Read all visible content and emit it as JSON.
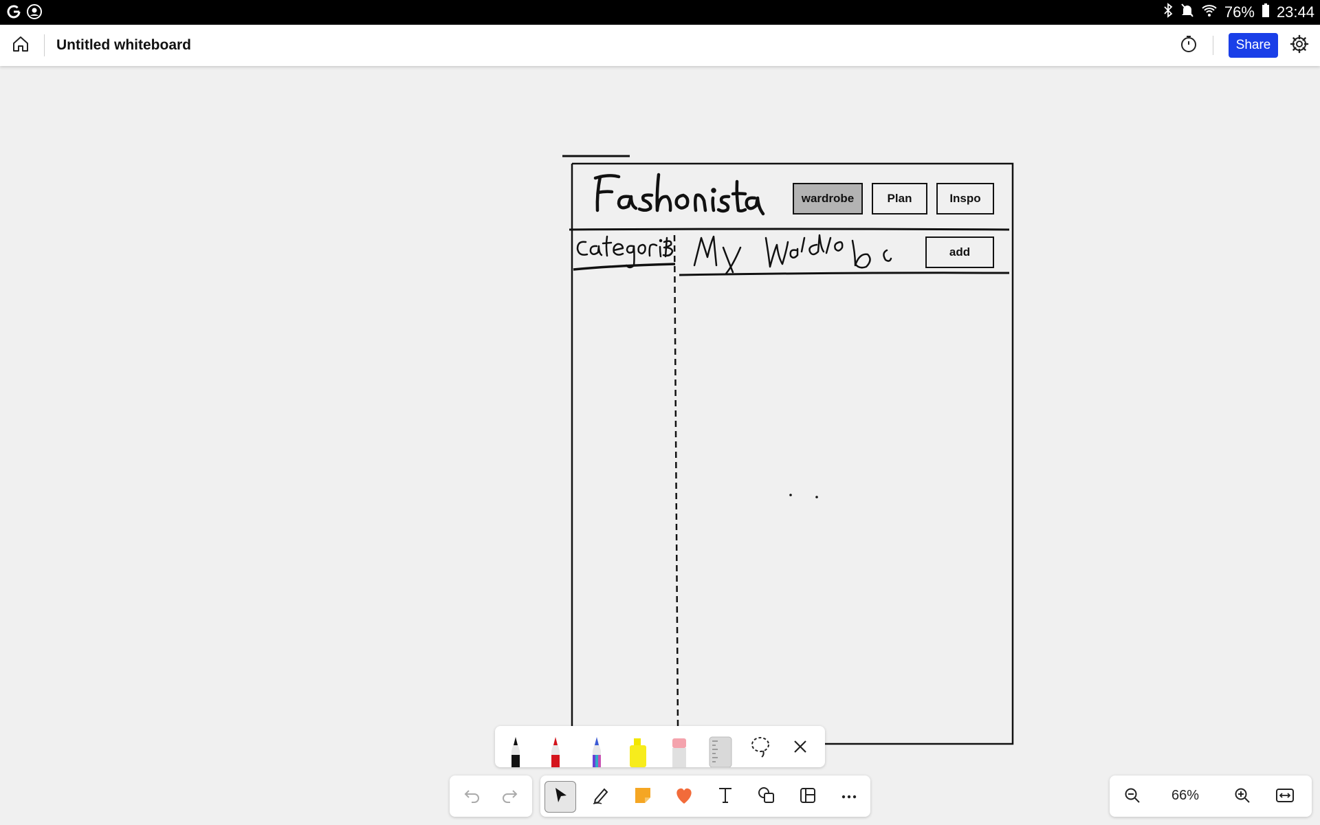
{
  "status_bar": {
    "left_icons": [
      "google-icon",
      "account-icon"
    ],
    "right_icons": [
      "bluetooth-icon",
      "mute-icon",
      "wifi-icon",
      "battery-icon"
    ],
    "battery": "76%",
    "time": "23:44"
  },
  "app_bar": {
    "title": "Untitled whiteboard",
    "share_label": "Share",
    "icons": [
      "home-icon",
      "timer-icon",
      "settings-icon"
    ]
  },
  "whiteboard": {
    "wireframe": {
      "handwritten": {
        "logo": "Fashonista",
        "sidebar_heading": "Categories",
        "main_heading": "My Wardrobe"
      },
      "nav_buttons": [
        {
          "label": "wardrobe",
          "active": true
        },
        {
          "label": "Plan",
          "active": false
        },
        {
          "label": "Inspo",
          "active": false
        }
      ],
      "add_button": "add"
    }
  },
  "pen_tray": {
    "tools": [
      "black-pen",
      "red-pen",
      "galaxy-pen",
      "yellow-highlighter",
      "pink-eraser",
      "ruler",
      "lasso-select"
    ],
    "close_icon": "close-icon"
  },
  "toolbar": {
    "history": [
      "undo-icon",
      "redo-icon"
    ],
    "tools": [
      "select-tool",
      "pen-tool",
      "sticky-note-tool",
      "reaction-tool",
      "text-tool",
      "shapes-tool",
      "templates-tool",
      "more-tool"
    ],
    "selected_tool": "select-tool",
    "accent_colors": {
      "sticky": "#f5a623",
      "reaction": "#f26b3a",
      "share": "#1a3fe8"
    }
  },
  "zoom": {
    "level": "66%",
    "icons": [
      "zoom-out-icon",
      "zoom-in-icon",
      "fit-width-icon"
    ]
  }
}
